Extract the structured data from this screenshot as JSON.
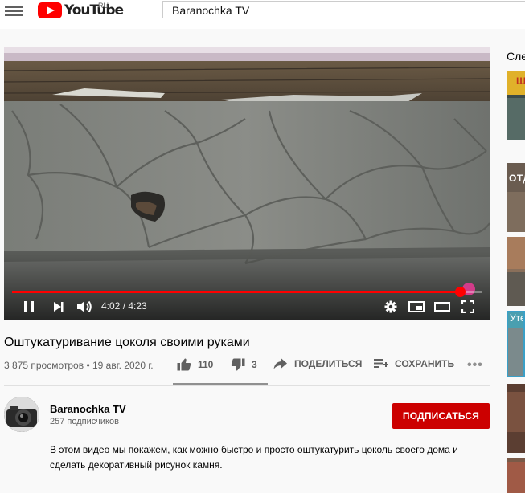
{
  "header": {
    "logo_text": "YouTube",
    "country_code": "RU",
    "search_value": "Baranochka TV"
  },
  "player": {
    "time_current": "4:02",
    "time_separator": " / ",
    "time_total": "4:23",
    "progress": 0.953
  },
  "video": {
    "title": "Оштукатуривание цоколя своими руками",
    "views": "3 875 просмотров",
    "date": "19 авг. 2020 г.",
    "likes": "110",
    "dislikes": "3",
    "share_label": "Поделиться",
    "save_label": "Сохранить"
  },
  "channel": {
    "name": "Baranochka TV",
    "subscribers": "257 подписчиков",
    "subscribe_label": "Подписаться",
    "description": "В этом видео мы покажем, как можно быстро и просто оштукатурить цоколь своего дома и сделать декоративный рисунок камня."
  },
  "sidebar": {
    "heading": "Сле",
    "thumb_texts": [
      "Ш",
      "ОТД",
      "Уте"
    ]
  },
  "colors": {
    "brand_red": "#ff0000",
    "subscribe_red": "#cc0000",
    "progress_red": "#ff0000",
    "meta_gray": "#606060"
  }
}
